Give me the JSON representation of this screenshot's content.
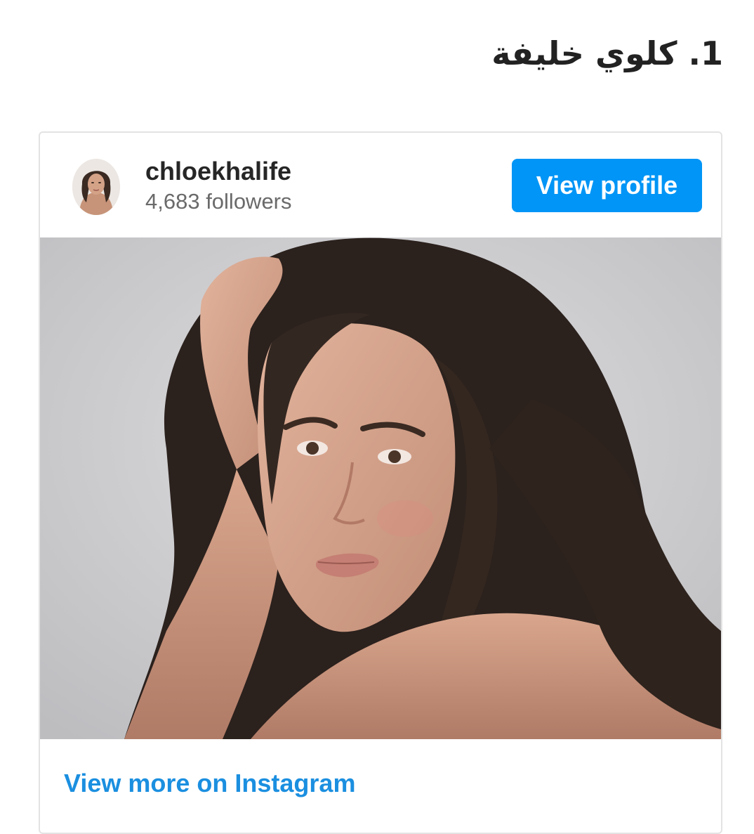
{
  "article": {
    "heading": "1. كلوي خليفة"
  },
  "embed": {
    "username": "chloekhalife",
    "followers": "4,683 followers",
    "view_profile_label": "View profile",
    "view_more_label": "View more on Instagram"
  },
  "colors": {
    "button_blue": "#0095f6",
    "link_blue": "#1b8fe0",
    "text_dark": "#262626",
    "text_muted": "#6a6a6a",
    "card_border": "#e3e3e3"
  },
  "icons": {
    "avatar": "profile-photo",
    "post": "portrait-photo"
  }
}
